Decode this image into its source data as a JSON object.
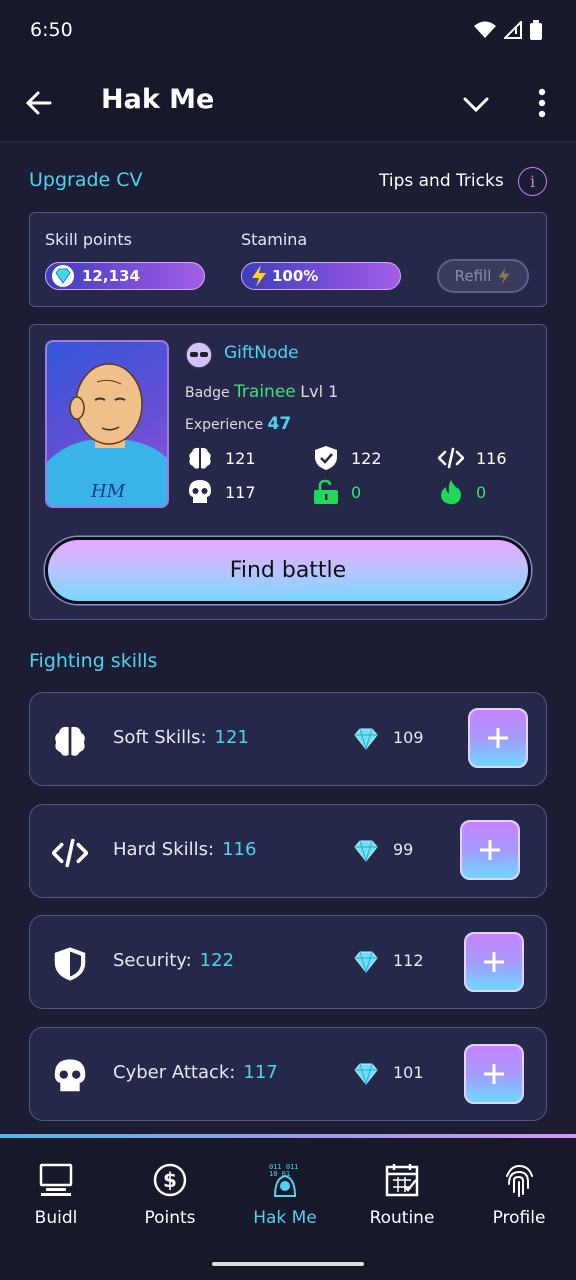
{
  "status": {
    "time": "6:50"
  },
  "appbar": {
    "title": "Hak Me"
  },
  "upgrade": {
    "title": "Upgrade CV",
    "tips_label": "Tips and Tricks",
    "info_glyph": "i"
  },
  "resources": {
    "skill_points_label": "Skill points",
    "skill_points_value": "12,134",
    "stamina_label": "Stamina",
    "stamina_value": "100%",
    "refill_label": "Refill"
  },
  "profile": {
    "username": "GiftNode",
    "badge_label": "Badge",
    "badge_value": "Trainee",
    "badge_level": "Lvl 1",
    "experience_label": "Experience",
    "experience_value": "47",
    "avatar_text": "HM",
    "stats": [
      {
        "icon": "brain-icon",
        "value": "121"
      },
      {
        "icon": "shield-check-icon",
        "value": "122"
      },
      {
        "icon": "code-icon",
        "value": "116"
      },
      {
        "icon": "skull-icon",
        "value": "117"
      },
      {
        "icon": "unlock-icon",
        "value": "0"
      },
      {
        "icon": "fire-icon",
        "value": "0"
      }
    ],
    "find_battle_label": "Find battle"
  },
  "fighting": {
    "title": "Fighting skills",
    "skills": [
      {
        "name": "Soft Skills:",
        "value": "121",
        "cost": "109",
        "icon": "brain-icon"
      },
      {
        "name": "Hard Skills:",
        "value": "116",
        "cost": "99",
        "icon": "code-icon"
      },
      {
        "name": "Security:",
        "value": "122",
        "cost": "112",
        "icon": "shield-icon"
      },
      {
        "name": "Cyber Attack:",
        "value": "117",
        "cost": "101",
        "icon": "skull-icon"
      }
    ]
  },
  "nav": {
    "items": [
      {
        "label": "Buidl",
        "icon": "computer-icon"
      },
      {
        "label": "Points",
        "icon": "dollar-icon"
      },
      {
        "label": "Hak Me",
        "icon": "hacker-icon",
        "active": true
      },
      {
        "label": "Routine",
        "icon": "calendar-icon"
      },
      {
        "label": "Profile",
        "icon": "fingerprint-icon"
      }
    ]
  },
  "colors": {
    "accent": "#4fd3f0",
    "green": "#3de07a",
    "bg": "#1c1d33"
  }
}
